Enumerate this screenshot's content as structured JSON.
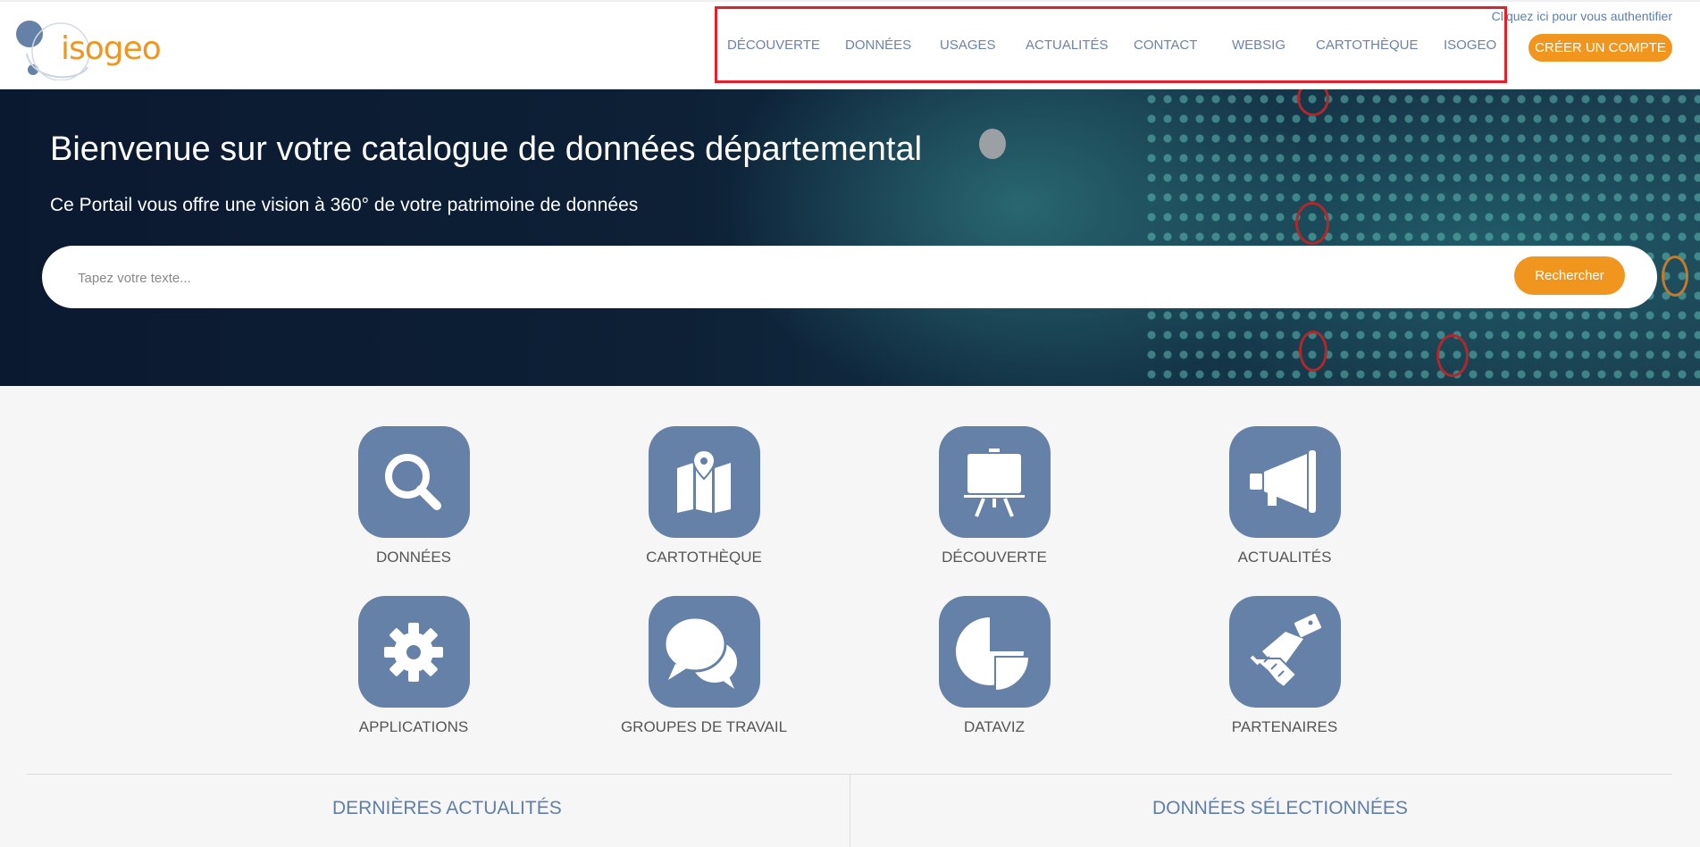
{
  "header": {
    "logo_text": "isogeo",
    "auth_link": "Cliquez ici pour vous authentifier",
    "nav": [
      "DÉCOUVERTE",
      "DONNÉES",
      "USAGES",
      "ACTUALITÉS",
      "CONTACT",
      "WEBSIG",
      "CARTOTHÈQUE",
      "ISOGEO"
    ],
    "cta": "CRÉER UN COMPTE"
  },
  "hero": {
    "title": "Bienvenue sur votre catalogue de données départemental",
    "subtitle": "Ce Portail vous offre une vision à 360° de votre patrimoine de données",
    "search_placeholder": "Tapez votre texte...",
    "search_button": "Rechercher"
  },
  "tiles": [
    {
      "label": "DONNÉES",
      "icon": "magnifier-icon"
    },
    {
      "label": "CARTOTHÈQUE",
      "icon": "map-icon"
    },
    {
      "label": "DÉCOUVERTE",
      "icon": "easel-icon"
    },
    {
      "label": "ACTUALITÉS",
      "icon": "megaphone-icon"
    },
    {
      "label": "APPLICATIONS",
      "icon": "gear-icon"
    },
    {
      "label": "GROUPES DE TRAVAIL",
      "icon": "chat-bubbles-icon"
    },
    {
      "label": "DATAVIZ",
      "icon": "pie-chart-icon"
    },
    {
      "label": "PARTENAIRES",
      "icon": "handshake-icon"
    }
  ],
  "sections": {
    "left": "DERNIÈRES ACTUALITÉS",
    "right": "DONNÉES SÉLECTIONNÉES"
  },
  "colors": {
    "accent": "#f0961e",
    "tile": "#6681a7",
    "nav_text": "#6a83a8",
    "highlight_box": "#e3202a"
  }
}
